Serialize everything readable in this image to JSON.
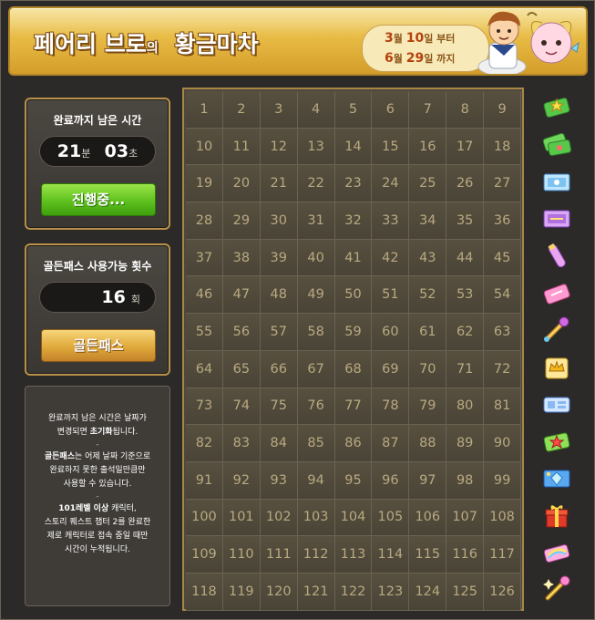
{
  "header": {
    "title_part1": "페어리 브로",
    "title_particle": "의",
    "title_part2": "황금마차",
    "period": {
      "start_month": "3",
      "start_month_unit": "월",
      "start_day": "10",
      "start_suffix": "일 부터",
      "end_month": "6",
      "end_month_unit": "월",
      "end_day": "29",
      "end_suffix": "일 까지"
    }
  },
  "timer_panel": {
    "title": "완료까지 남은 시간",
    "minutes": "21",
    "minutes_unit": "분",
    "seconds": "03",
    "seconds_unit": "초",
    "button_label": "진행중..."
  },
  "pass_panel": {
    "title": "골든패스 사용가능 횟수",
    "count": "16",
    "count_unit": "회",
    "button_label": "골든패스"
  },
  "info": {
    "line1": "완료까지 남은 시간은 날짜가",
    "line2_a": "변경되면 ",
    "line2_b": "초기화",
    "line2_c": "됩니다.",
    "sep1": "-",
    "line3_a": "골든패스",
    "line3_b": "는 어제 날짜 기준으로",
    "line4": "완료하지 못한 출석일만큼만",
    "line5": "사용할 수 있습니다.",
    "sep2": "-",
    "line6_a": "101레벨 이상",
    "line6_b": " 캐릭터,",
    "line7": "스토리 퀘스트 챕터 2를 완료한",
    "line8": "제로 캐릭터로 접속 중일 때만",
    "line9": "시간이 누적됩니다."
  },
  "grid": {
    "days": [
      "1",
      "2",
      "3",
      "4",
      "5",
      "6",
      "7",
      "8",
      "9",
      "10",
      "11",
      "12",
      "13",
      "14",
      "15",
      "16",
      "17",
      "18",
      "19",
      "20",
      "21",
      "22",
      "23",
      "24",
      "25",
      "26",
      "27",
      "28",
      "29",
      "30",
      "31",
      "32",
      "33",
      "34",
      "35",
      "36",
      "37",
      "38",
      "39",
      "40",
      "41",
      "42",
      "43",
      "44",
      "45",
      "46",
      "47",
      "48",
      "49",
      "50",
      "51",
      "52",
      "53",
      "54",
      "55",
      "56",
      "57",
      "58",
      "59",
      "60",
      "61",
      "62",
      "63",
      "64",
      "65",
      "66",
      "67",
      "68",
      "69",
      "70",
      "71",
      "72",
      "73",
      "74",
      "75",
      "76",
      "77",
      "78",
      "79",
      "80",
      "81",
      "82",
      "83",
      "84",
      "85",
      "86",
      "87",
      "88",
      "89",
      "90",
      "91",
      "92",
      "93",
      "94",
      "95",
      "96",
      "97",
      "98",
      "99",
      "100",
      "101",
      "102",
      "103",
      "104",
      "105",
      "106",
      "107",
      "108",
      "109",
      "110",
      "111",
      "112",
      "113",
      "114",
      "115",
      "116",
      "117",
      "118",
      "119",
      "120",
      "121",
      "122",
      "123",
      "124",
      "125",
      "126"
    ]
  },
  "rewards": [
    {
      "icon": "green-ticket-star-icon"
    },
    {
      "icon": "green-ticket-multi-icon"
    },
    {
      "icon": "blue-coupon-icon"
    },
    {
      "icon": "purple-coupon-icon"
    },
    {
      "icon": "potion-tube-icon"
    },
    {
      "icon": "pink-ticket-icon"
    },
    {
      "icon": "magic-key-icon"
    },
    {
      "icon": "gold-crown-scroll-icon"
    },
    {
      "icon": "blue-ticket-icon"
    },
    {
      "icon": "green-ticket-red-star-icon"
    },
    {
      "icon": "blue-gem-coupon-icon"
    },
    {
      "icon": "red-gift-box-icon"
    },
    {
      "icon": "rainbow-scroll-icon"
    },
    {
      "icon": "sparkle-key-icon"
    }
  ],
  "colors": {
    "header_gold": "#e7bb45",
    "panel_border": "#b8904a",
    "grid_text": "#b9a981",
    "button_green": "#5ec11e",
    "button_gold": "#e0a93b"
  }
}
